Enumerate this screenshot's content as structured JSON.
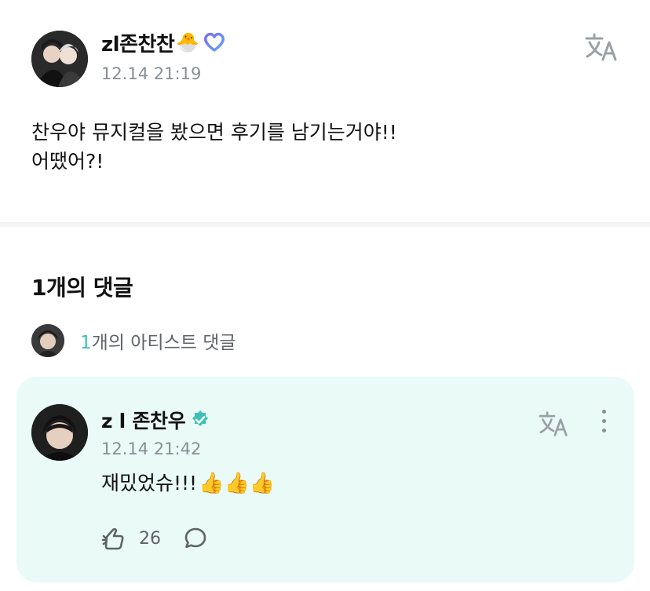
{
  "post": {
    "username": "zl존찬찬",
    "username_emoji": "🐣",
    "timestamp": "12.14 21:19",
    "body_lines": [
      "찬우야 뮤지컬을 봤으면 후기를 남기는거야!!",
      "어땠어?!"
    ],
    "translate_icon": "translate-icon",
    "membership_badge_icon": "heart-badge-icon"
  },
  "comments": {
    "count_label": "1개의 댓글",
    "artist_summary": {
      "count": "1",
      "label": "개의 아티스트 댓글"
    },
    "items": [
      {
        "author": "z l 존찬우",
        "verified_icon": "verified-check-icon",
        "timestamp": "12.14 21:42",
        "text": "재밌었슈!!!",
        "emoji": "👍👍👍",
        "like_count": "26",
        "like_icon": "like-hand-icon",
        "reply_icon": "reply-bubble-icon",
        "menu_icon": "more-vertical-icon"
      }
    ]
  },
  "colors": {
    "accent_teal": "#3ec1b5",
    "card_bg": "#e9faf7",
    "muted_text": "#8a8f96",
    "badge_purple": "#7b6cf2",
    "badge_blue": "#5aa8f5"
  }
}
